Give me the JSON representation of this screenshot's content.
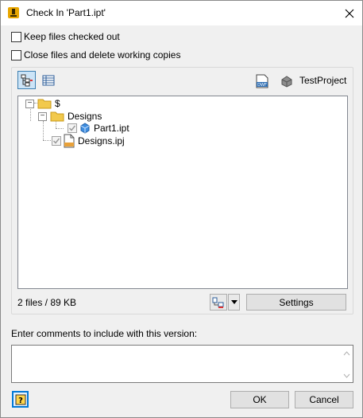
{
  "window": {
    "title": "Check In 'Part1.ipt'",
    "close_label": "✕"
  },
  "options": {
    "keep_checked_out": "Keep files checked out",
    "close_delete": "Close files and delete working copies"
  },
  "toolbar": {
    "project_name": "TestProject"
  },
  "tree": {
    "root_label": "$",
    "folder_label": "Designs",
    "part_label": "Part1.ipt",
    "project_file_label": "Designs.ipj",
    "expander_symbol": "−"
  },
  "status": {
    "files_summary": "2 files / 89 KB"
  },
  "buttons": {
    "settings": "Settings",
    "ok": "OK",
    "cancel": "Cancel"
  },
  "comments": {
    "prompt": "Enter comments to include with this version:",
    "value": ""
  },
  "colors": {
    "accent": "#0078d7",
    "folder_yellow": "#f2c94c",
    "part_blue": "#3f8ee0"
  }
}
